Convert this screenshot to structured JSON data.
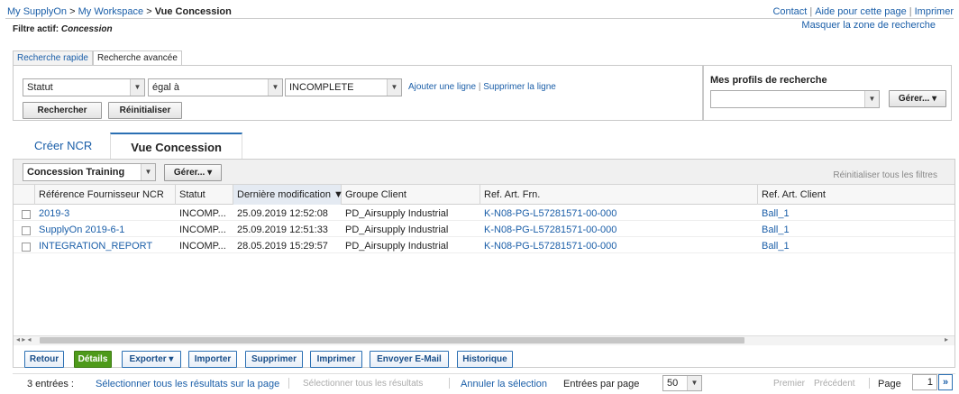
{
  "header": {
    "breadcrumb": [
      "My SupplyOn",
      "My Workspace",
      "Vue Concession"
    ],
    "breadcrumb_sep": ">",
    "top_links": [
      "Contact",
      "Aide pour cette page",
      "Imprimer"
    ],
    "hide_search": "Masquer la zone de recherche",
    "filter_label": "Filtre actif:",
    "filter_value": "Concession"
  },
  "search": {
    "tabs": [
      "Recherche rapide",
      "Recherche avancée"
    ],
    "field": "Statut",
    "operator": "égal à",
    "value": "INCOMPLETE",
    "add_line": "Ajouter une ligne",
    "remove_line": "Supprimer la ligne",
    "link_sep": "|",
    "search_button": "Rechercher",
    "reset_button": "Réinitialiser",
    "profiles_title": "Mes profils de recherche",
    "profile_value": "",
    "manage_button": "Gérer... ▾"
  },
  "main_tabs": [
    "Créer NCR",
    "Vue Concession"
  ],
  "grid": {
    "view_select": "Concession Training",
    "manage_button": "Gérer... ▾",
    "reset_filters": "Réinitialiser tous les filtres",
    "columns": [
      "Référence Fournisseur NCR",
      "Statut",
      "Dernière modification ▼",
      "Groupe Client",
      "Ref. Art. Frn.",
      "Ref. Art. Client"
    ],
    "rows": [
      [
        "2019-3",
        "INCOMP...",
        "25.09.2019 12:52:08",
        "PD_Airsupply Industrial",
        "K-N08-PG-L57281571-00-000",
        "Ball_1"
      ],
      [
        "SupplyOn 2019-6-1",
        "INCOMP...",
        "25.09.2019 12:51:33",
        "PD_Airsupply Industrial",
        "K-N08-PG-L57281571-00-000",
        "Ball_1"
      ],
      [
        "INTEGRATION_REPORT",
        "INCOMP...",
        "28.05.2019 15:29:57",
        "PD_Airsupply Industrial",
        "K-N08-PG-L57281571-00-000",
        "Ball_1"
      ]
    ]
  },
  "actions": {
    "back": "Retour",
    "details": "Détails",
    "export": "Exporter ▾",
    "import": "Importer",
    "delete": "Supprimer",
    "print": "Imprimer",
    "email": "Envoyer E-Mail",
    "history": "Historique"
  },
  "footer": {
    "entries": "3 entrées :",
    "select_all_page": "Sélectionner tous les résultats sur la page",
    "select_all": "Sélectionner tous les résultats",
    "cancel_selection": "Annuler la sélection",
    "per_page_label": "Entrées par page",
    "per_page_value": "50",
    "first": "Premier",
    "previous": "Précédent",
    "page_label": "Page",
    "page_value": "1",
    "next_icon": "»"
  },
  "colors": {
    "link": "#1a5ea8",
    "accent_blue": "#2a6fb3",
    "details_green": "#4e9a1a"
  }
}
